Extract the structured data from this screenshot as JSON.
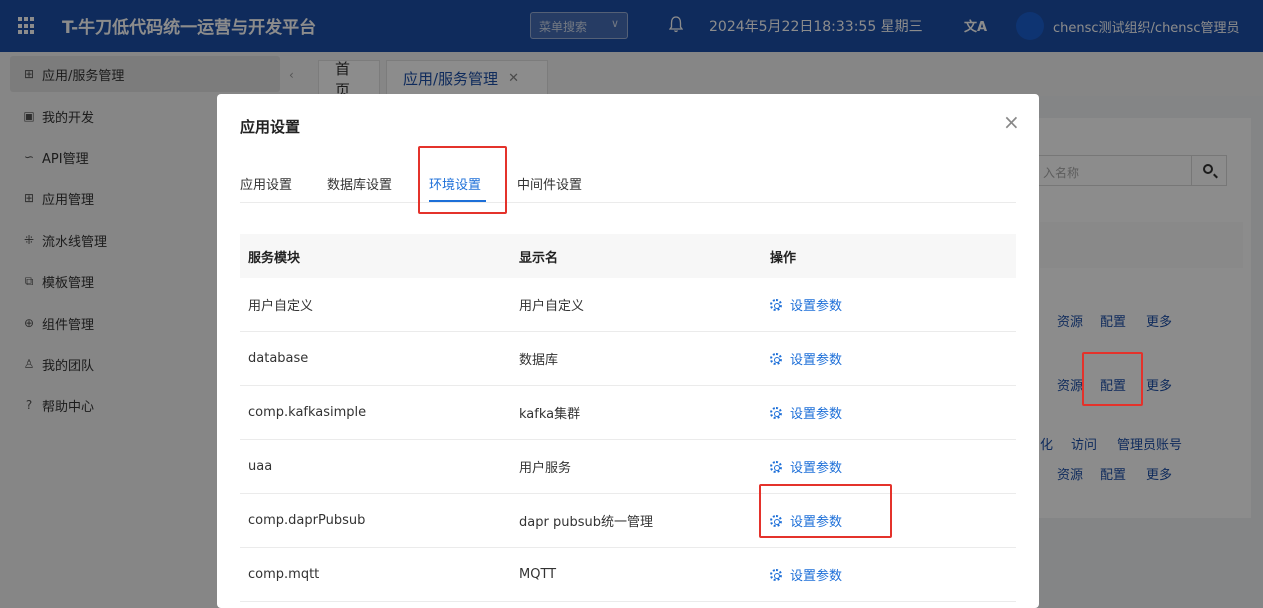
{
  "header": {
    "title": "T-牛刀低代码统一运营与开发平台",
    "menu_search_placeholder": "菜单搜索",
    "datetime": "2024年5月22日18:33:55 星期三",
    "translate_label": "文A",
    "user": "chensc测试组织/chensc管理员"
  },
  "sidebar": {
    "items": [
      {
        "icon": "app-service-icon",
        "glyph": "⊞",
        "label": "应用/服务管理"
      },
      {
        "icon": "my-dev-icon",
        "glyph": "▣",
        "label": "我的开发"
      },
      {
        "icon": "api-icon",
        "glyph": "∽",
        "label": "API管理"
      },
      {
        "icon": "app-grid-icon",
        "glyph": "⊞",
        "label": "应用管理"
      },
      {
        "icon": "pipeline-icon",
        "glyph": "⁜",
        "label": "流水线管理"
      },
      {
        "icon": "template-icon",
        "glyph": "⧉",
        "label": "模板管理"
      },
      {
        "icon": "component-icon",
        "glyph": "⊕",
        "label": "组件管理"
      },
      {
        "icon": "team-icon",
        "glyph": "♙",
        "label": "我的团队"
      },
      {
        "icon": "help-icon",
        "glyph": "?",
        "label": "帮助中心"
      }
    ]
  },
  "tabbar": {
    "home": "首页",
    "current": "应用/服务管理"
  },
  "background": {
    "search_placeholder": "入名称",
    "links": [
      "资源",
      "配置",
      "更多",
      "资源",
      "配置",
      "更多",
      "化",
      "访问",
      "管理员账号",
      "资源",
      "配置",
      "更多"
    ]
  },
  "modal": {
    "title": "应用设置",
    "tabs": [
      "应用设置",
      "数据库设置",
      "环境设置",
      "中间件设置"
    ],
    "active_tab": "环境设置",
    "columns": [
      "服务模块",
      "显示名",
      "操作"
    ],
    "rows": [
      {
        "module": "用户自定义",
        "display": "用户自定义",
        "action": "设置参数"
      },
      {
        "module": "database",
        "display": "数据库",
        "action": "设置参数"
      },
      {
        "module": "comp.kafkasimple",
        "display": "kafka集群",
        "action": "设置参数"
      },
      {
        "module": "uaa",
        "display": "用户服务",
        "action": "设置参数"
      },
      {
        "module": "comp.daprPubsub",
        "display": "dapr pubsub统一管理",
        "action": "设置参数"
      },
      {
        "module": "comp.mqtt",
        "display": "MQTT",
        "action": "设置参数"
      }
    ]
  },
  "colors": {
    "header": "#1d4fa8",
    "accent": "#1d6fd8",
    "highlight": "#e4322b"
  }
}
